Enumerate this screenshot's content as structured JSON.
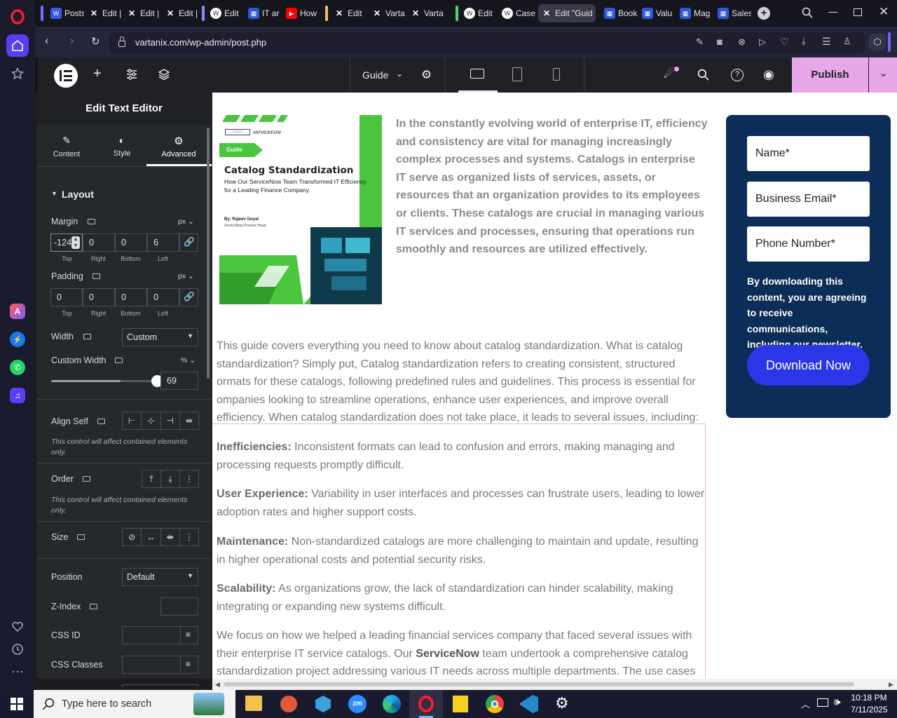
{
  "browser": {
    "url": "vartanix.com/wp-admin/post.php",
    "tabs": [
      {
        "label": "Posts",
        "icon": "wordpress-icon"
      },
      {
        "label": "Edit |",
        "icon": "elementor-x-icon"
      },
      {
        "label": "Edit |",
        "icon": "elementor-x-icon"
      },
      {
        "label": "Edit |",
        "icon": "elementor-x-icon"
      },
      {
        "label": "Edit",
        "icon": "wordpress-icon"
      },
      {
        "label": "IT ar",
        "icon": "page-icon"
      },
      {
        "label": "How",
        "icon": "youtube-icon"
      },
      {
        "label": "Edit",
        "icon": "elementor-x-icon"
      },
      {
        "label": "Varta",
        "icon": "elementor-x-icon"
      },
      {
        "label": "Varta",
        "icon": "elementor-x-icon"
      },
      {
        "label": "Edit",
        "icon": "wordpress-icon"
      },
      {
        "label": "Case",
        "icon": "wordpress-icon"
      },
      {
        "label": "Edit \"Guid",
        "icon": "elementor-x-icon"
      },
      {
        "label": "Book",
        "icon": "page-icon"
      },
      {
        "label": "Valu",
        "icon": "page-icon"
      },
      {
        "label": "Mag",
        "icon": "page-icon"
      },
      {
        "label": "Sales",
        "icon": "page-icon"
      }
    ]
  },
  "elementor": {
    "template_name": "Guide",
    "publish_label": "Publish"
  },
  "panel": {
    "title": "Edit Text Editor",
    "tabs": [
      "Content",
      "Style",
      "Advanced"
    ],
    "section": "Layout",
    "margin": {
      "label": "Margin",
      "unit": "px",
      "top": "-124",
      "right": "0",
      "bottom": "0",
      "left": "6"
    },
    "padding": {
      "label": "Padding",
      "unit": "px",
      "top": "0",
      "right": "0",
      "bottom": "0",
      "left": "0"
    },
    "sub_labels": [
      "Top",
      "Right",
      "Bottom",
      "Left"
    ],
    "width": {
      "label": "Width",
      "value": "Custom"
    },
    "custom_width": {
      "label": "Custom Width",
      "unit": "%",
      "value": "69",
      "slider_fraction": 0.69
    },
    "align_self": "Align Self",
    "note": "This control will affect contained elements only.",
    "order": "Order",
    "size": "Size",
    "position": {
      "label": "Position",
      "value": "Default"
    },
    "zindex": "Z-Index",
    "css_id": "CSS ID",
    "css_classes": "CSS Classes"
  },
  "page": {
    "cover": {
      "guide_tag": "Guide",
      "brand": "servicenow",
      "title": "Catalog Standardization",
      "subtitle": "How Our ServiceNow Team Transformed IT Efficiency for a Leading Finance Company",
      "author": "By: Rajeev Goyal",
      "author_role": "ServiceNow Practice Head"
    },
    "intro": "In the constantly evolving world of enterprise IT, efficiency and consistency are vital for managing increasingly complex processes and systems. Catalogs in enterprise IT serve as organized lists of services, assets, or resources that an organization provides to its employees or clients. These catalogs are crucial in managing various IT services and processes, ensuring that operations run smoothly and resources are utilized effectively.",
    "para1": "This guide covers everything you need to know about catalog standardization. What is catalog standardization? Simply put, Catalog standardization refers to creating consistent, structured ormats for these catalogs, following predefined rules and guidelines. This process is essential for ompanies looking to streamline operations, enhance user experiences, and improve overall efficiency. When catalog standardization does not take place, it leads to several issues, including:",
    "issues": [
      {
        "term": "Inefficiencies:",
        "text": " Inconsistent formats can lead to confusion and errors, making managing and processing requests promptly difficult."
      },
      {
        "term": "User Experience:",
        "text": " Variability in user interfaces and processes can frustrate users, leading to lower adoption rates and higher support costs."
      },
      {
        "term": "Maintenance:",
        "text": " Non-standardized catalogs are more challenging to maintain and update, resulting in higher operational costs and potential security risks."
      },
      {
        "term": "Scalability:",
        "text": " As organizations grow, the lack of standardization can hinder scalability, making integrating or expanding new systems difficult."
      }
    ],
    "para_last_a": "We focus on how we helped a leading financial services company that faced several issues with their enterprise IT service catalogs. Our ",
    "para_last_b": "ServiceNow",
    "para_last_c": " team undertook a comprehensive catalog standardization project addressing various IT needs across multiple departments. The use cases",
    "form": {
      "name": "Name*",
      "email": "Business Email*",
      "phone": "Phone Number*",
      "consent": "By downloading this content, you are agreeing to receive communications, including our newsletter.",
      "button": "Download Now"
    }
  },
  "taskbar": {
    "search_placeholder": "Type here to search",
    "time": "10:18 PM",
    "date": "7/11/2025"
  },
  "colors": {
    "publish_bg": "#e8a7e8",
    "form_bg": "#0c2d57",
    "download_btn": "#2b36e9",
    "cover_green": "#4bc43e"
  }
}
